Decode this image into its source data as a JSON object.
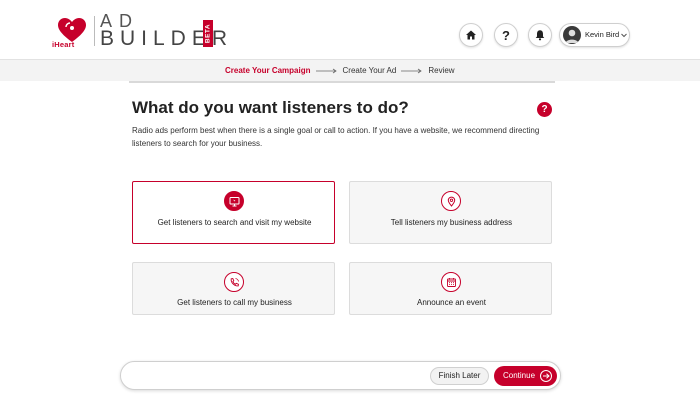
{
  "brand": {
    "logo_text": "iHeart",
    "ad": "AD",
    "builder": "BUILDER",
    "beta": "BETA"
  },
  "header": {
    "home_icon": "home-icon",
    "help_icon": "question-icon",
    "notifications_icon": "bell-icon",
    "user_name": "Kevin Bird"
  },
  "steps": [
    {
      "label": "Create Your Campaign",
      "active": true
    },
    {
      "label": "Create Your Ad",
      "active": false
    },
    {
      "label": "Review",
      "active": false
    }
  ],
  "main": {
    "title": "What do you want listeners to do?",
    "help_glyph": "?",
    "description": "Radio ads perform best when there is a single goal or call to action. If you have a website, we recommend directing listeners to search for your business."
  },
  "options": [
    {
      "label": "Get listeners to search and visit my website",
      "icon": "monitor-icon",
      "selected": true
    },
    {
      "label": "Tell listeners my business address",
      "icon": "location-pin-icon",
      "selected": false
    },
    {
      "label": "Get listeners to call my business",
      "icon": "phone-icon",
      "selected": false
    },
    {
      "label": "Announce an event",
      "icon": "calendar-icon",
      "selected": false
    }
  ],
  "footer": {
    "finish_label": "Finish Later",
    "continue_label": "Continue"
  },
  "colors": {
    "accent": "#c6002b",
    "card_bg": "#f6f6f6",
    "steps_bg": "#f3f3f3"
  }
}
